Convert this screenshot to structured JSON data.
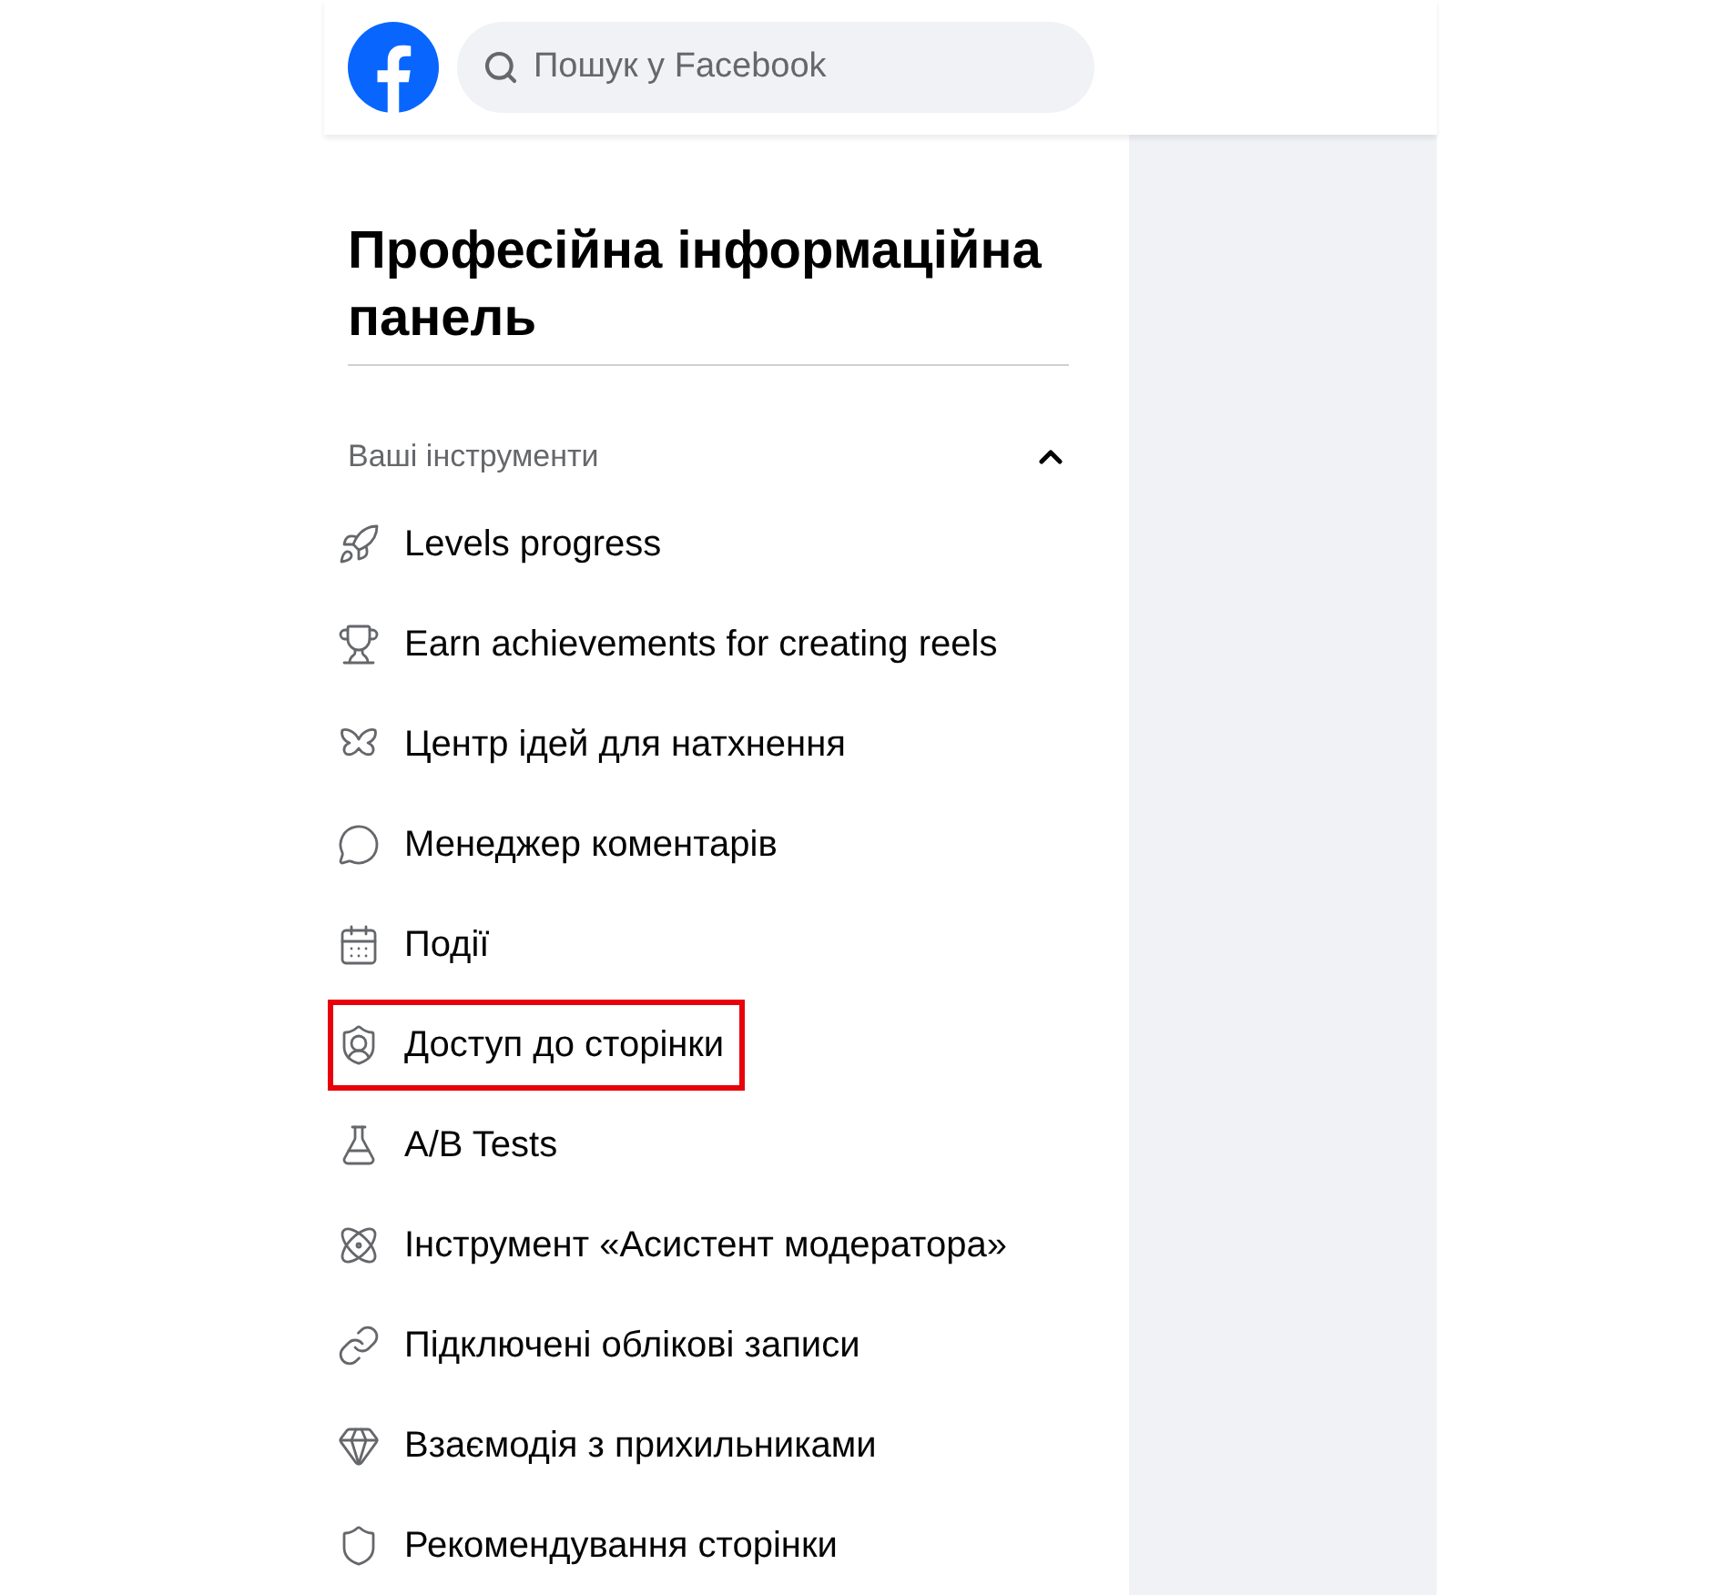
{
  "header": {
    "search": {
      "placeholder": "Пошук у Facebook"
    }
  },
  "panel": {
    "title": "Професійна інформаційна панель",
    "section": {
      "title": "Ваші інструменти",
      "expanded": true,
      "items": [
        {
          "label": "Levels progress",
          "highlighted": false
        },
        {
          "label": "Earn achievements for creating reels",
          "highlighted": false
        },
        {
          "label": "Центр ідей для натхнення",
          "highlighted": false
        },
        {
          "label": "Менеджер коментарів",
          "highlighted": false
        },
        {
          "label": "Події",
          "highlighted": false
        },
        {
          "label": "Доступ до сторінки",
          "highlighted": true
        },
        {
          "label": "A/B Tests",
          "highlighted": false
        },
        {
          "label": "Інструмент «Асистент модератора»",
          "highlighted": false
        },
        {
          "label": "Підключені облікові записи",
          "highlighted": false
        },
        {
          "label": "Взаємодія з прихильниками",
          "highlighted": false
        },
        {
          "label": "Рекомендування сторінки",
          "highlighted": false
        }
      ]
    }
  }
}
